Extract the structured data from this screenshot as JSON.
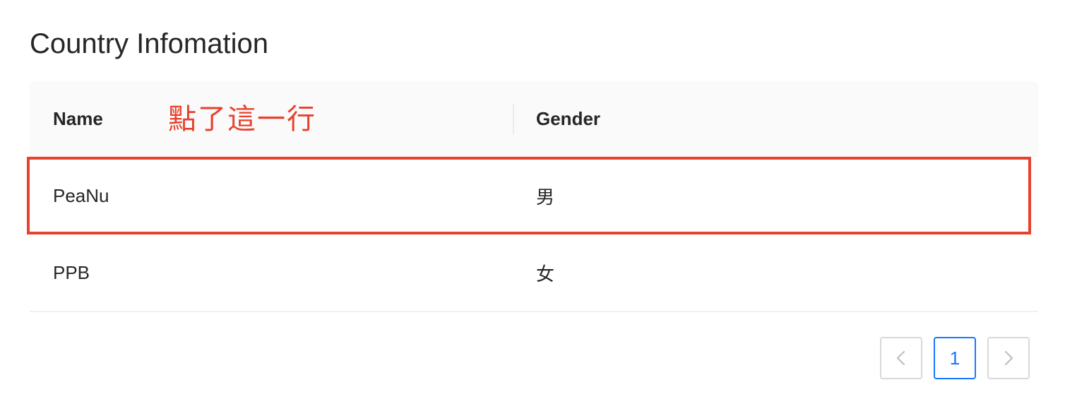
{
  "page": {
    "title": "Country Infomation"
  },
  "table": {
    "columns": [
      {
        "label": "Name"
      },
      {
        "label": "Gender"
      }
    ],
    "annotation": "點了這一行",
    "rows": [
      {
        "name": "PeaNu",
        "gender": "男",
        "highlighted": true
      },
      {
        "name": "PPB",
        "gender": "女",
        "highlighted": false
      }
    ]
  },
  "pagination": {
    "prev_icon": "chevron-left-icon",
    "current_page": "1",
    "next_icon": "chevron-right-icon"
  },
  "colors": {
    "annotation_red": "#e8412e",
    "accent_blue": "#1677ff",
    "header_bg": "#fafafa",
    "border": "#d9d9d9"
  }
}
